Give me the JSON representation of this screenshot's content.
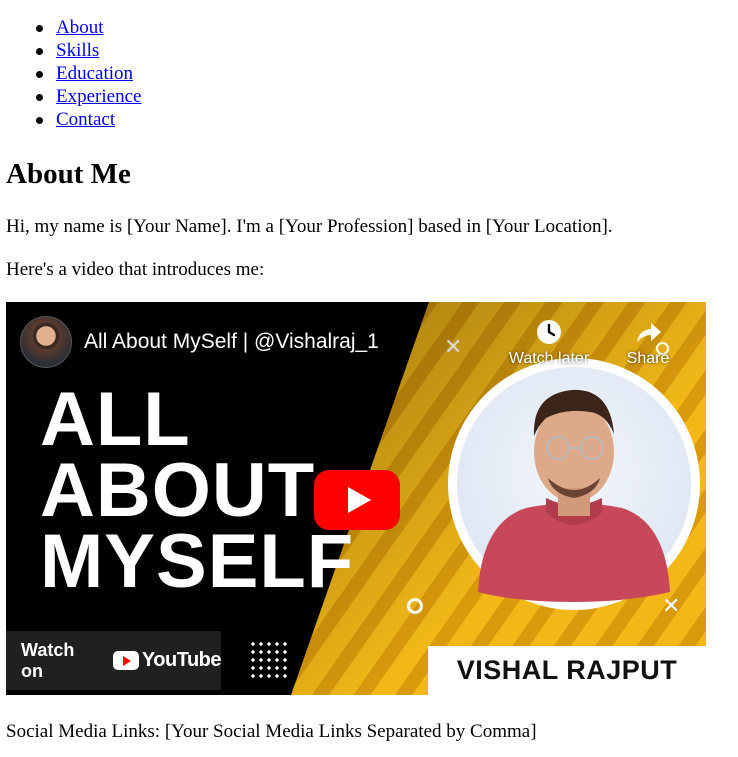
{
  "nav": [
    {
      "label": "About"
    },
    {
      "label": "Skills"
    },
    {
      "label": "Education"
    },
    {
      "label": "Experience"
    },
    {
      "label": "Contact"
    }
  ],
  "about": {
    "heading": "About Me",
    "intro": "Hi, my name is [Your Name]. I'm a [Your Profession] based in [Your Location].",
    "video_lead": "Here's a video that introduces me:",
    "social": "Social Media Links: [Your Social Media Links Separated by Comma]"
  },
  "video": {
    "title": "All About MySelf | @Vishalraj_1",
    "watch_later": "Watch later",
    "share": "Share",
    "watch_on": "Watch on",
    "youtube_word": "YouTube",
    "thumbnail_text_lines": [
      "ALL",
      "ABOUT",
      "MYSELF"
    ],
    "thumbnail_name": "VISHAL RAJPUT",
    "icons": [
      "clock-icon",
      "share-arrow-icon",
      "play-icon",
      "youtube-logo-icon",
      "close-icon"
    ],
    "colors": {
      "play_red": "#ff0000",
      "banner_yellow": "#f2b818",
      "banner_dark": "#000000"
    }
  },
  "colors": {
    "link": "#0000ee",
    "text": "#000000"
  }
}
